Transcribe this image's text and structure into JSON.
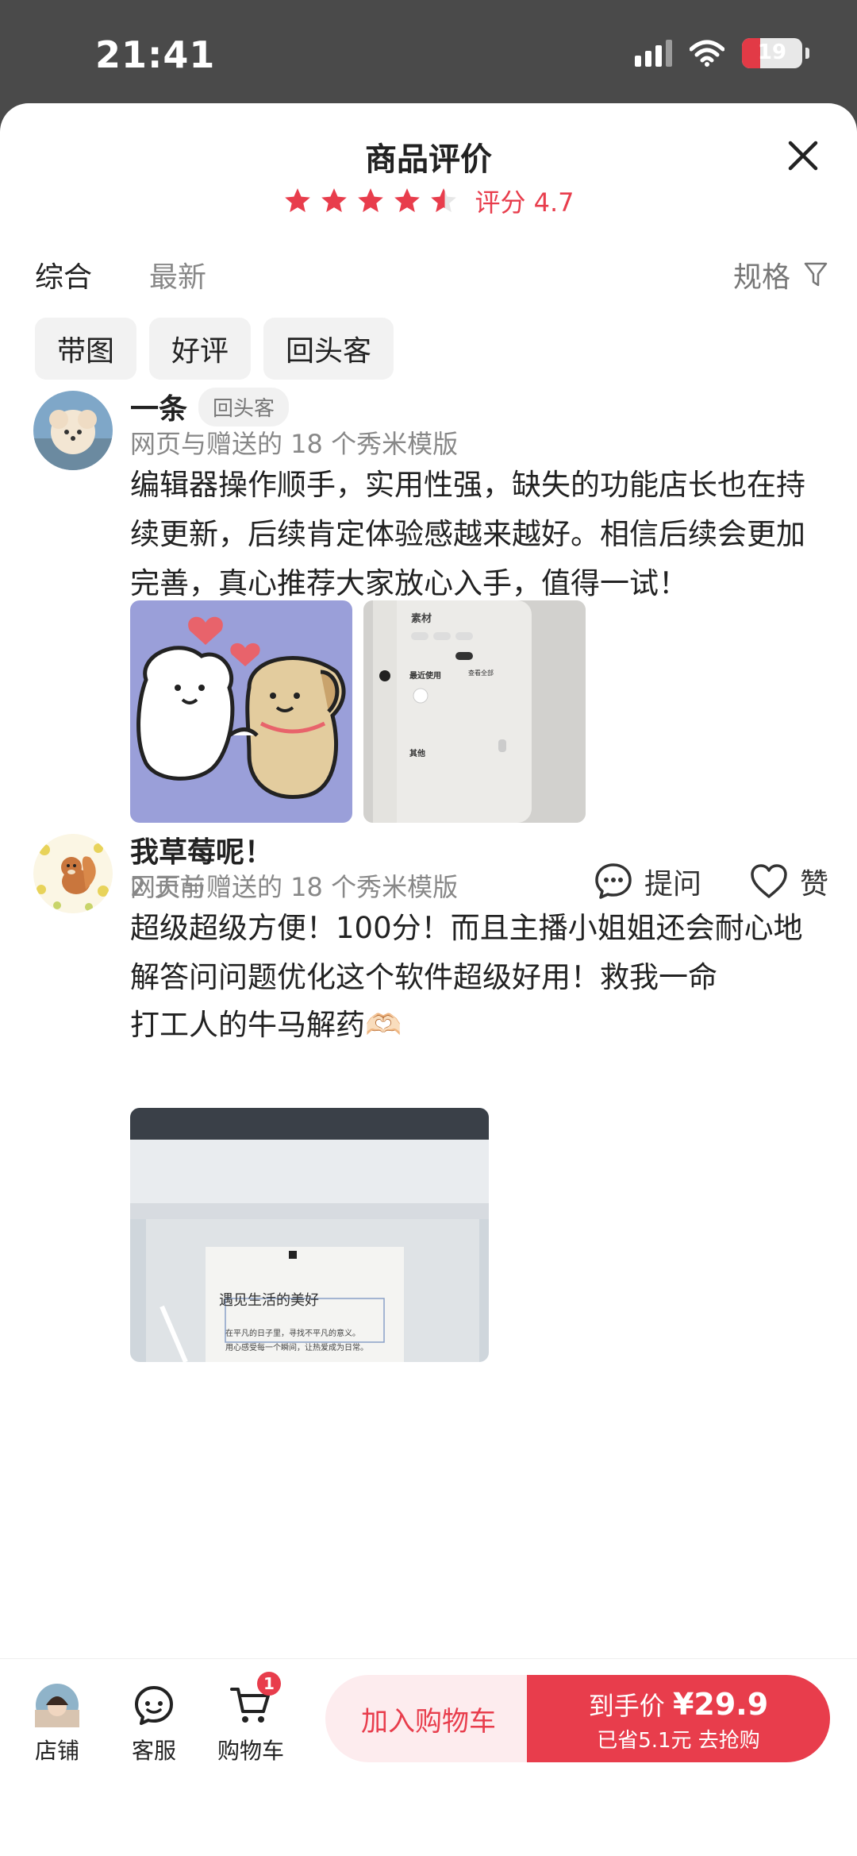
{
  "status_bar": {
    "time": "21:41",
    "battery": "19"
  },
  "header": {
    "title": "商品评价",
    "rating_text": "评分 4.7",
    "stars": 4.7
  },
  "tabs": [
    {
      "label": "综合"
    },
    {
      "label": "最新"
    }
  ],
  "spec_filter": "规格",
  "chips": [
    "带图",
    "好评",
    "回头客"
  ],
  "reviews": [
    {
      "name": "一条",
      "badge": "回头客",
      "spec": "网页与赠送的 18 个秀米模版",
      "body": "编辑器操作顺手，实用性强，缺失的功能店长也在持续更新，后续肯定体验感越来越好。相信后续会更加完善，真心推荐大家放心入手，值得一试！",
      "time": "2 天前",
      "ask_label": "提问",
      "like_label": "赞",
      "photo2_title": "素材",
      "photo2_section1": "最近使用",
      "photo2_more": "查看全部",
      "photo2_section2": "其他"
    },
    {
      "name": "我草莓呢！",
      "spec": "网页与赠送的 18 个秀米模版",
      "body": "超级超级方便！100分！而且主播小姐姐还会耐心地解答问问题优化这个软件超级好用！救我一命",
      "body2": "打工人的牛马解药🫶🏻",
      "photo_heading": "遇见生活的美好",
      "photo_text1": "在平凡的日子里，寻找不平凡的意义。",
      "photo_text2": "用心感受每一个瞬间，让热爱成为日常。"
    }
  ],
  "bottom_bar": {
    "shop": "店铺",
    "service": "客服",
    "cart": "购物车",
    "cart_count": "1",
    "add_to_cart": "加入购物车",
    "price_label": "到手价",
    "price": "¥29.9",
    "saved": "已省5.1元 去抢购"
  },
  "colors": {
    "accent": "#e83d4c"
  }
}
